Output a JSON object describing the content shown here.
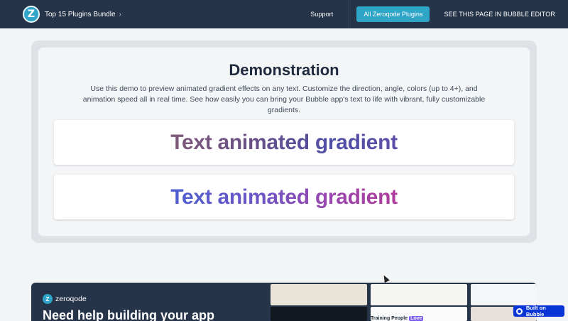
{
  "header": {
    "logo_letter": "Z",
    "bundle_title": "Top 15 Plugins Bundle",
    "support_label": "Support",
    "all_plugins_label": "All Zeroqode Plugins",
    "editor_label": "SEE THIS PAGE IN BUBBLE EDITOR"
  },
  "demo": {
    "title": "Demonstration",
    "description": "Use this demo to preview animated gradient effects on any text. Customize the direction, angle, colors (up to 4+), and animation speed all in real time. See how easily you can bring your Bubble app's text to life with vibrant, fully customizable gradients.",
    "sample_1": "Text animated gradient",
    "sample_2": "Text animated gradient"
  },
  "banner": {
    "brand": "zeroqode",
    "headline": "Need help building your app",
    "preview_caption": "Training People",
    "preview_highlight": "Love"
  },
  "built_on": "Built on Bubble",
  "colors": {
    "header_bg": "#263449",
    "accent": "#2ea4c7",
    "bubble_badge": "#0a35d6"
  }
}
